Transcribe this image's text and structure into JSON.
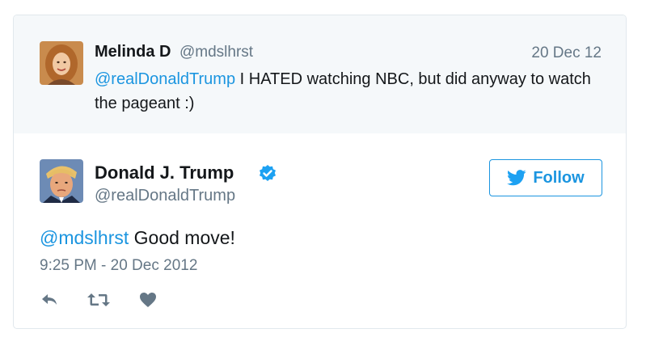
{
  "parent_tweet": {
    "name": "Melinda D",
    "handle": "@mdslhrst",
    "date": "20 Dec 12",
    "mention": "@realDonaldTrump",
    "text": " I HATED watching NBC, but did anyway to watch the pageant :)"
  },
  "main_tweet": {
    "name": "Donald J. Trump",
    "handle": "@realDonaldTrump",
    "follow_label": "Follow",
    "mention": "@mdslhrst",
    "text": " Good move!",
    "timestamp": "9:25 PM - 20 Dec 2012"
  },
  "icons": {
    "verified": "verified-badge-icon",
    "twitter_bird": "twitter-bird-icon",
    "reply": "reply-icon",
    "retweet": "retweet-icon",
    "like": "heart-icon"
  },
  "colors": {
    "link": "#1b95e0",
    "muted": "#657786",
    "text": "#14171a",
    "parent_bg": "#f5f8fa",
    "action_gray": "#657786"
  }
}
